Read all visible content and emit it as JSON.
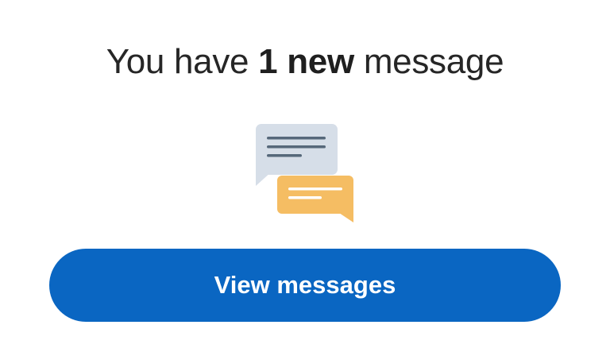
{
  "notification": {
    "prefix": "You have ",
    "count_text": "1 new",
    "suffix": " message"
  },
  "illustration": {
    "icon": "chat-bubbles-icon",
    "colors": {
      "back_bubble": "#d6dee8",
      "back_lines": "#56687a",
      "front_bubble": "#f5bd63",
      "front_lines": "#ffffff"
    }
  },
  "cta": {
    "label": "View messages",
    "color": "#0a66c2"
  }
}
